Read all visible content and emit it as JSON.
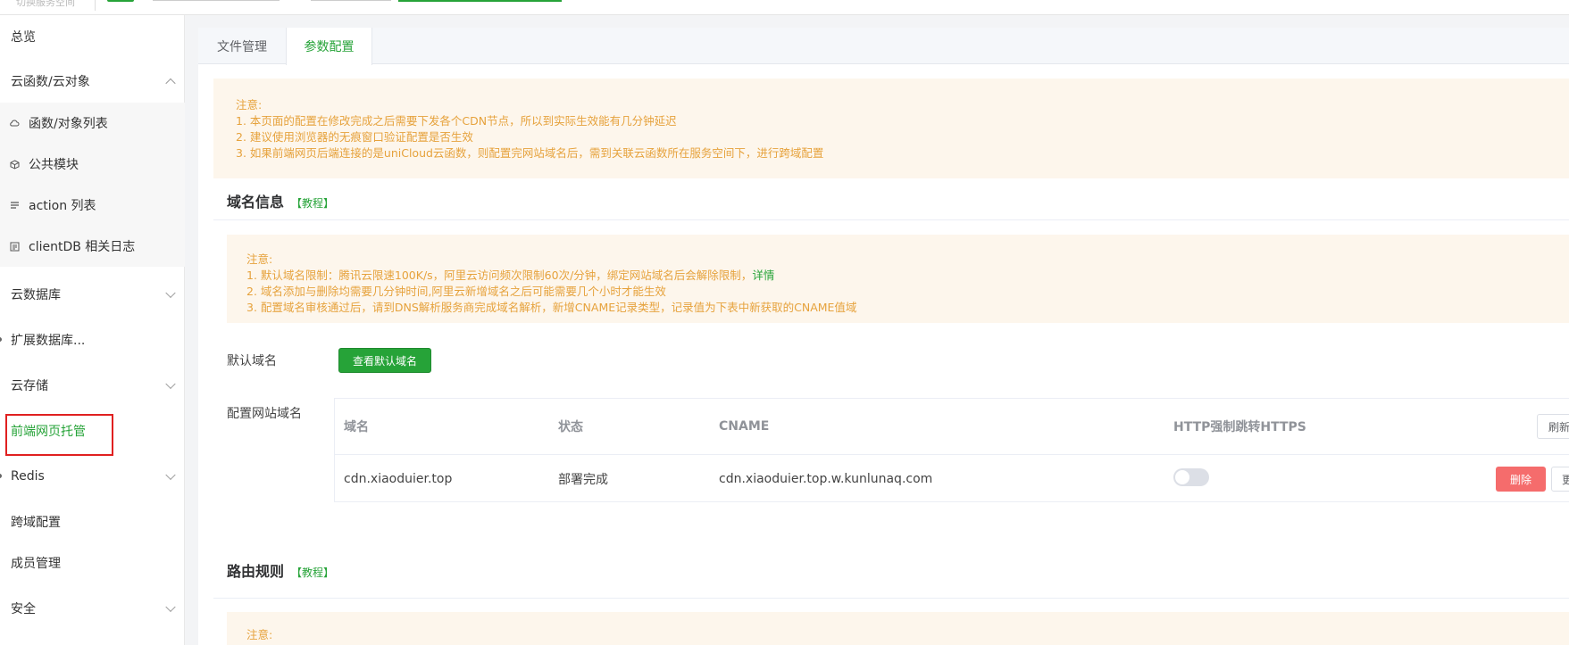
{
  "topbar": {
    "breadcrumb_text": "切换服务空间"
  },
  "sidebar": {
    "overview": "总览",
    "cloud_functions": "云函数/云对象",
    "sub_items": [
      {
        "label": "函数/对象列表",
        "icon": "cloud-icon"
      },
      {
        "label": "公共模块",
        "icon": "cube-icon"
      },
      {
        "label": "action 列表",
        "icon": "list-icon"
      },
      {
        "label": "clientDB 相关日志",
        "icon": "log-icon"
      }
    ],
    "database": "云数据库",
    "ext_database": "扩展数据库...",
    "storage": "云存储",
    "web_hosting": "前端网页托管",
    "redis": "Redis",
    "cors": "跨域配置",
    "members": "成员管理",
    "security": "安全"
  },
  "tabs": {
    "files": "文件管理",
    "params": "参数配置"
  },
  "notice1": {
    "title": "注意:",
    "lines": [
      "1. 本页面的配置在修改完成之后需要下发各个CDN节点，所以到实际生效能有几分钟延迟",
      "2. 建议使用浏览器的无痕窗口验证配置是否生效",
      "3. 如果前端网页后端连接的是uniCloud云函数，则配置完网站域名后，需到关联云函数所在服务空间下，进行跨域配置"
    ]
  },
  "domain_section": {
    "title": "域名信息",
    "tutorial": "【教程】"
  },
  "notice2": {
    "title": "注意:",
    "line1": "1. 默认域名限制：腾讯云限速100K/s，阿里云访问频次限制60次/分钟，绑定网站域名后会解除限制，",
    "line1_link": "详情",
    "line2": "2. 域名添加与删除均需要几分钟时间,阿里云新增域名之后可能需要几个小时才能生效",
    "line3": "3. 配置域名审核通过后，请到DNS解析服务商完成域名解析，新增CNAME记录类型，记录值为下表中新获取的CNAME值域"
  },
  "default_domain": {
    "label": "默认域名",
    "button": "查看默认域名"
  },
  "site_domain": {
    "label": "配置网站域名",
    "headers": {
      "domain": "域名",
      "status": "状态",
      "cname": "CNAME",
      "https": "HTTP强制跳转HTTPS"
    },
    "refresh": "刷新",
    "rows": [
      {
        "domain": "cdn.xiaoduier.top",
        "status": "部署完成",
        "cname": "cdn.xiaoduier.top.w.kunlunaq.com",
        "https_enabled": false,
        "delete": "删除",
        "more": "更"
      }
    ]
  },
  "route_section": {
    "title": "路由规则",
    "tutorial": "【教程】",
    "notice_title": "注意:"
  }
}
